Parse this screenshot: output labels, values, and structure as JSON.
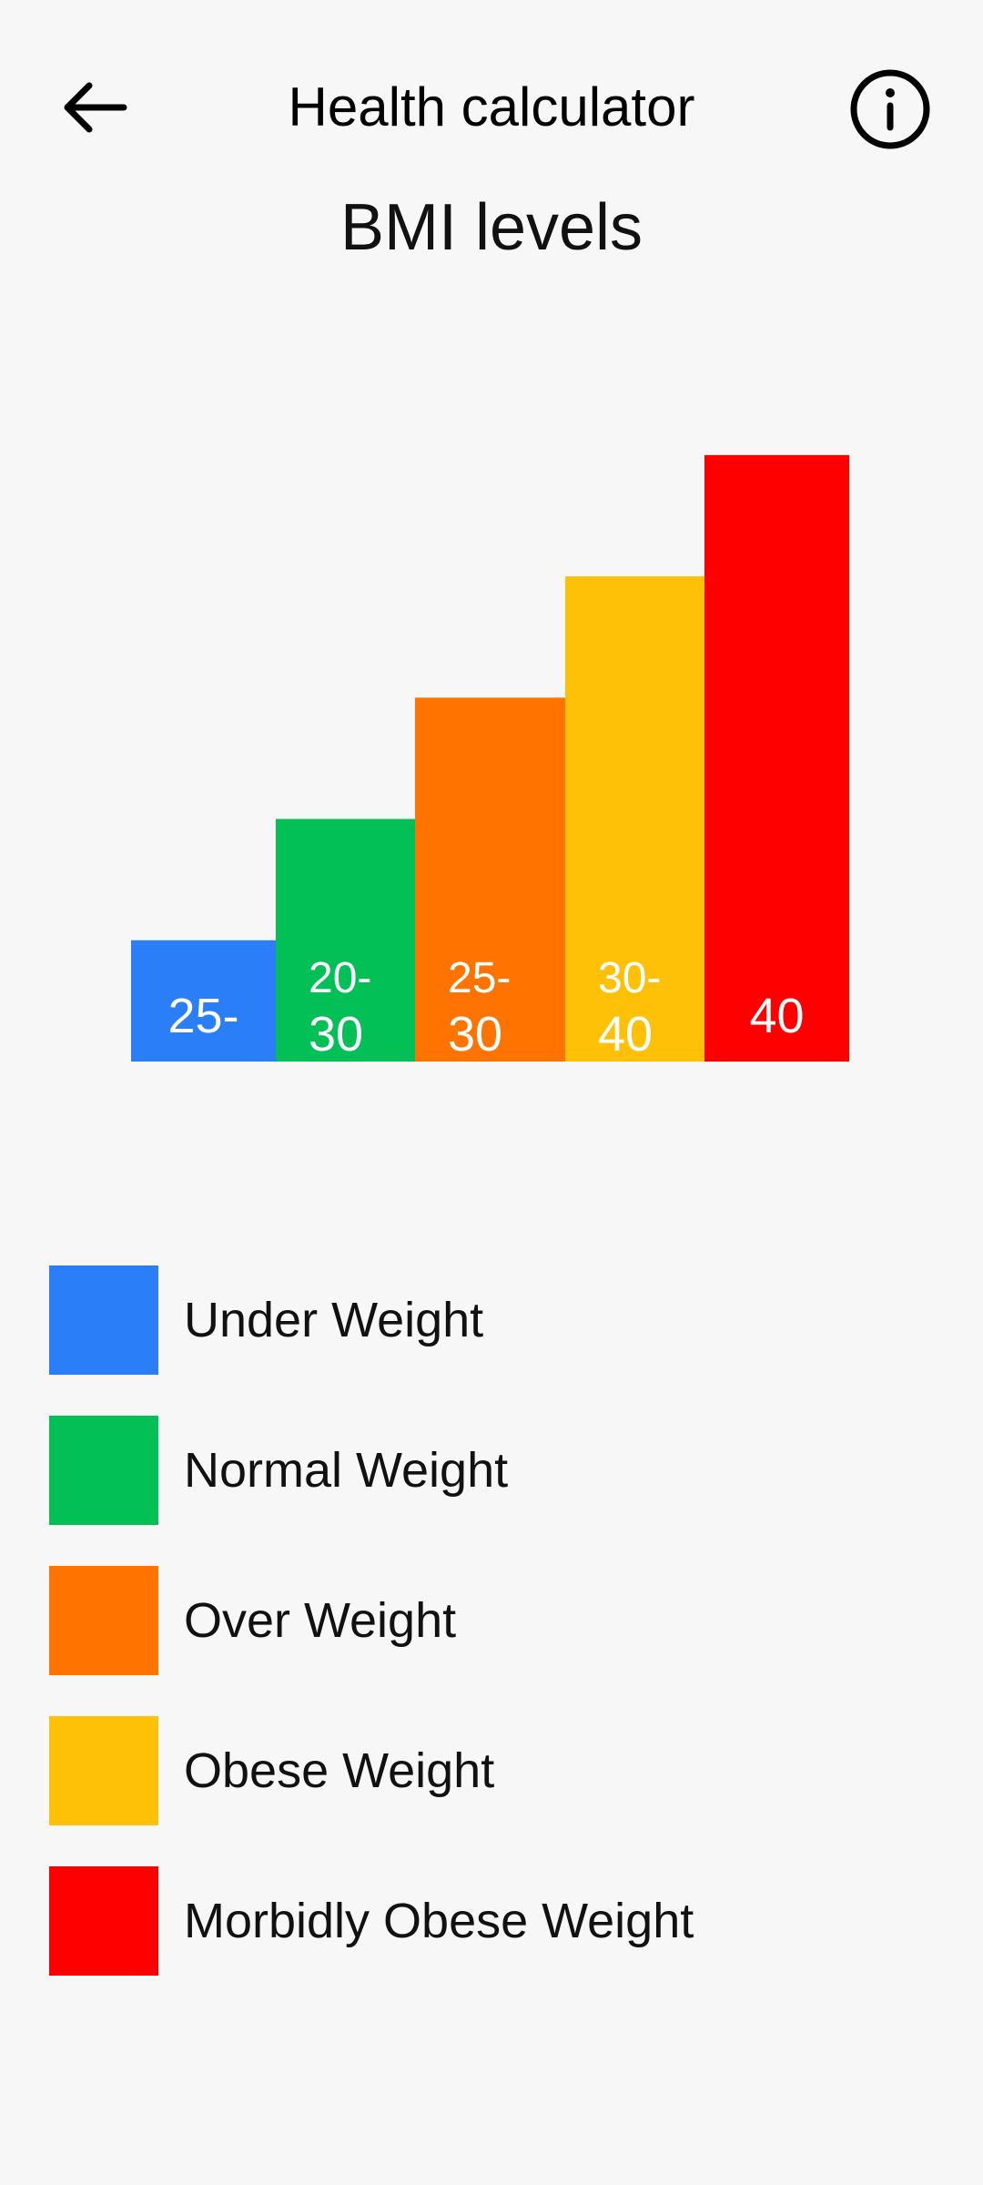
{
  "header": {
    "title": "Health calculator",
    "back_icon": "arrow-left-icon",
    "info_icon": "info-circle-icon"
  },
  "chart_title": "BMI levels",
  "chart_data": {
    "type": "bar",
    "title": "BMI levels",
    "categories": [
      "Under Weight",
      "Normal Weight",
      "Over Weight",
      "Obese Weight",
      "Morbidly Obese Weight"
    ],
    "bar_labels": [
      [
        "25-"
      ],
      [
        "20-",
        "30"
      ],
      [
        "25-",
        "30"
      ],
      [
        "30-",
        "40"
      ],
      [
        "40"
      ]
    ],
    "values": [
      1,
      2,
      3,
      4,
      5
    ],
    "ylim": [
      0,
      6.5
    ],
    "colors": [
      "#2a7ef7",
      "#02bf56",
      "#ff7300",
      "#ffc107",
      "#ff0000"
    ],
    "legend_placement": "bottom"
  },
  "legend": [
    {
      "label": "Under Weight",
      "color": "#2a7ef7"
    },
    {
      "label": "Normal Weight",
      "color": "#02bf56"
    },
    {
      "label": "Over Weight",
      "color": "#ff7300"
    },
    {
      "label": "Obese Weight",
      "color": "#ffc107"
    },
    {
      "label": "Morbidly Obese Weight",
      "color": "#ff0000"
    }
  ]
}
